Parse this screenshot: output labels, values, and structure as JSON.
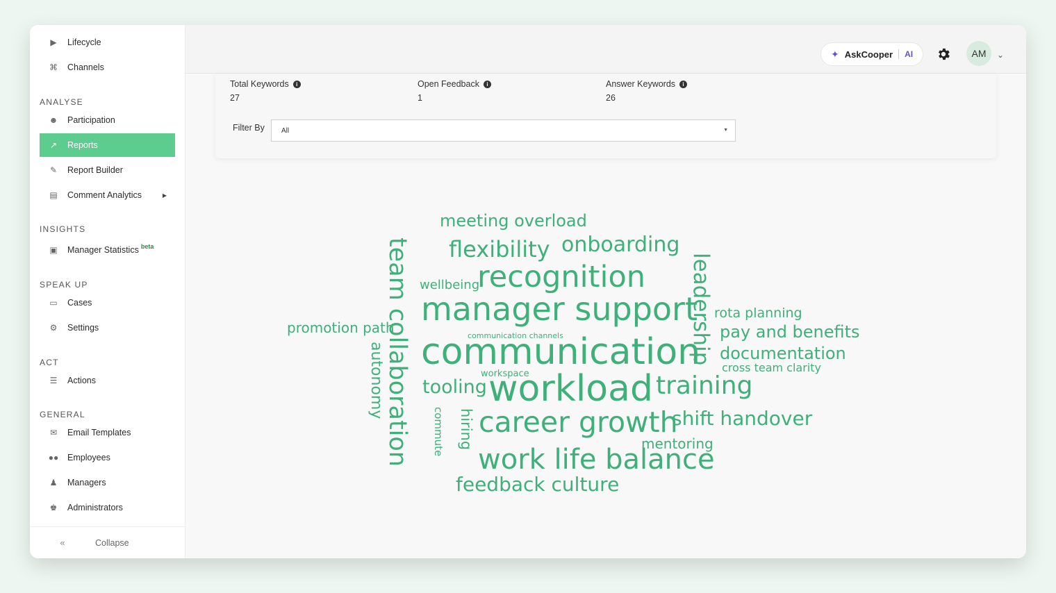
{
  "sidebar": {
    "top_items": [
      {
        "label": "Lifecycle",
        "icon": "megaphone-icon"
      },
      {
        "label": "Channels",
        "icon": "antenna-icon"
      }
    ],
    "sections": [
      {
        "title": "ANALYSE",
        "items": [
          {
            "label": "Participation",
            "icon": "user-check-icon"
          },
          {
            "label": "Reports",
            "icon": "chart-line-icon",
            "active": true
          },
          {
            "label": "Report Builder",
            "icon": "file-edit-icon"
          },
          {
            "label": "Comment Analytics",
            "icon": "bar-chart-icon"
          }
        ]
      },
      {
        "title": "INSIGHTS",
        "items": [
          {
            "label": "Manager Statistics",
            "badge": "beta",
            "icon": "presentation-icon"
          }
        ]
      },
      {
        "title": "SPEAK UP",
        "items": [
          {
            "label": "Cases",
            "icon": "folder-icon"
          },
          {
            "label": "Settings",
            "icon": "gear-icon"
          }
        ]
      },
      {
        "title": "ACT",
        "items": [
          {
            "label": "Actions",
            "icon": "list-icon"
          }
        ]
      },
      {
        "title": "GENERAL",
        "items": [
          {
            "label": "Email Templates",
            "icon": "email-template-icon"
          },
          {
            "label": "Employees",
            "icon": "users-icon"
          },
          {
            "label": "Managers",
            "icon": "user-tie-icon"
          },
          {
            "label": "Administrators",
            "icon": "crown-icon"
          }
        ]
      }
    ],
    "collapse_label": "Collapse"
  },
  "header": {
    "ask_label": "AskCooper",
    "ask_ai": "AI",
    "avatar_initials": "AM"
  },
  "stats": [
    {
      "label": "Total Keywords",
      "value": "27"
    },
    {
      "label": "Open Feedback",
      "value": "1"
    },
    {
      "label": "Answer Keywords",
      "value": "26"
    }
  ],
  "filter": {
    "label": "Filter By",
    "value": "All"
  },
  "word_cloud": {
    "color": "#3fb07a",
    "words": [
      "meeting overload",
      "flexibility",
      "onboarding",
      "wellbeing",
      "recognition",
      "manager support",
      "rota planning",
      "pay and benefits",
      "promotion path",
      "communication channels",
      "communication",
      "documentation",
      "cross team clarity",
      "workspace",
      "tooling",
      "workload",
      "training",
      "career growth",
      "shift handover",
      "mentoring",
      "work life balance",
      "feedback culture",
      "team collaboration",
      "leadership",
      "autonomy",
      "commute",
      "hiring"
    ]
  },
  "colors": {
    "accent": "#5ccc8f",
    "ai": "#6a4be0"
  }
}
